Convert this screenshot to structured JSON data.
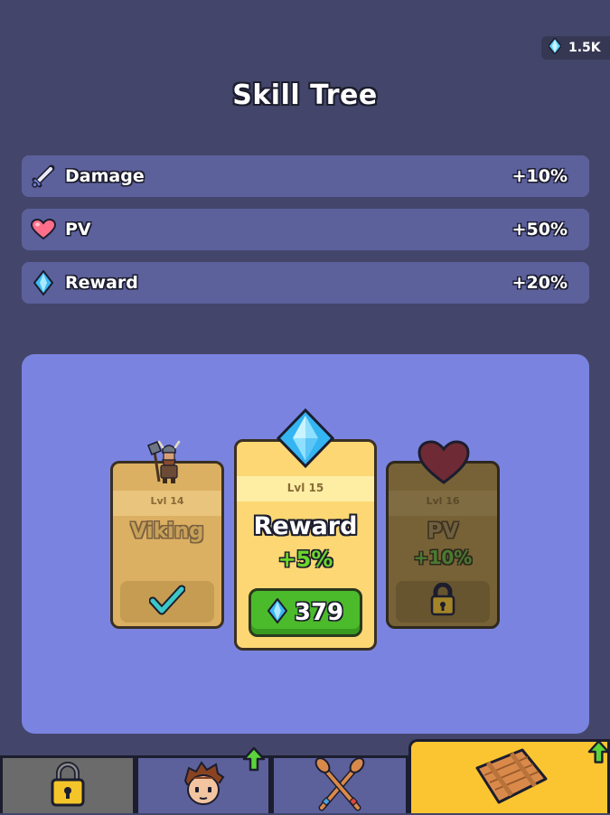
{
  "currency": {
    "icon": "diamond-icon",
    "value": "1.5K"
  },
  "title": "Skill Tree",
  "stats": [
    {
      "icon": "sword-icon",
      "label": "Damage",
      "value": "+10%"
    },
    {
      "icon": "heart-icon",
      "label": "PV",
      "value": "+50%"
    },
    {
      "icon": "diamond-icon",
      "label": "Reward",
      "value": "+20%"
    }
  ],
  "cards": {
    "viking": {
      "level": "Lvl 14",
      "name": "Viking",
      "status": "completed"
    },
    "reward": {
      "level": "Lvl 15",
      "name": "Reward",
      "bonus": "+5%",
      "price": "379"
    },
    "pv": {
      "level": "Lvl 16",
      "name": "PV",
      "bonus": "+10%",
      "status": "locked"
    }
  },
  "tabs": [
    {
      "icon": "lock-icon",
      "badge": false
    },
    {
      "icon": "hero-face-icon",
      "badge": true
    },
    {
      "icon": "crossed-oars-icon",
      "badge": false
    },
    {
      "icon": "wooden-raft-icon",
      "badge": true,
      "selected": true
    }
  ],
  "colors": {
    "background": "#43466a",
    "panel": "#7a84e0",
    "buy_green": "#4bbb2b",
    "selected_tab": "#fbc531"
  }
}
